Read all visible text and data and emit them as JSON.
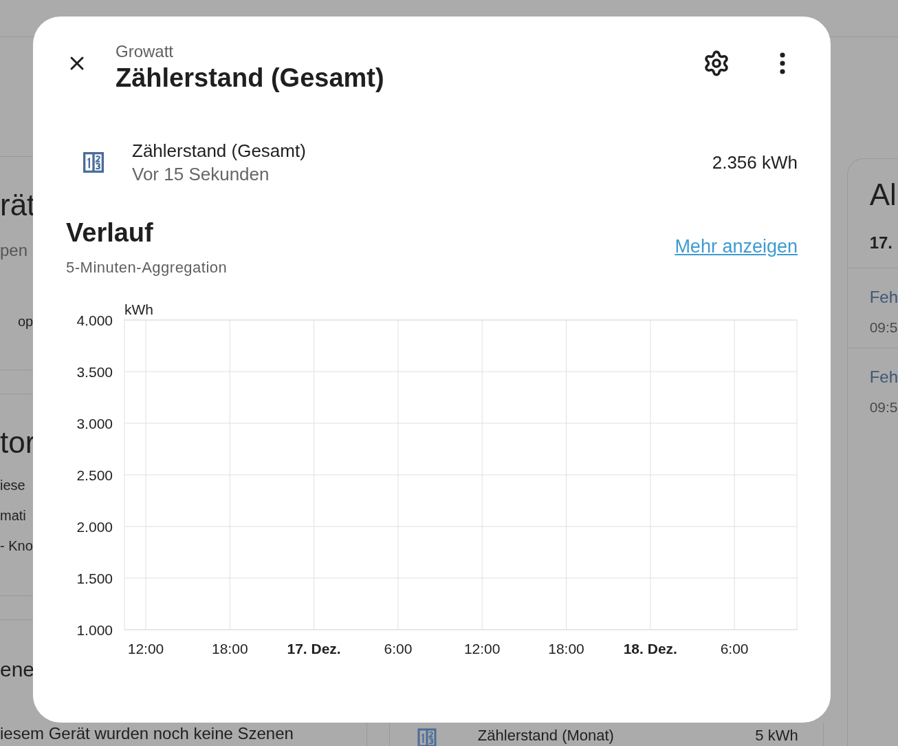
{
  "background": {
    "left_cards": [
      {
        "title": "rät",
        "subtitle": "pen",
        "item": "op"
      },
      {
        "title": "tor",
        "lines": [
          "iese",
          "mati",
          "- Kno"
        ]
      },
      {
        "title": "ene",
        "text": "iesem Gerät wurden noch keine Szenen"
      }
    ],
    "middle_card": {
      "row": {
        "name": "Zählerstand (Monat)",
        "value": "5 kWh"
      }
    },
    "right_card": {
      "title": "Al",
      "date": "17.",
      "entries": [
        {
          "title": "Feh",
          "time": "09:5"
        },
        {
          "title": "Feh",
          "time": "09:5"
        }
      ]
    }
  },
  "dialog": {
    "subtitle": "Growatt",
    "title": "Zählerstand (Gesamt)",
    "entity": {
      "name": "Zählerstand (Gesamt)",
      "last_changed": "Vor 15 Sekunden",
      "state": "2.356 kWh"
    },
    "history": {
      "title": "Verlauf",
      "subtitle": "5-Minuten-Aggregation",
      "link": "Mehr anzeigen",
      "chart_data": {
        "type": "line",
        "ylabel": "kWh",
        "grid": true,
        "ylim": [
          1000,
          4000
        ],
        "categories": [
          "12:00",
          "18:00",
          "**17. Dez.**",
          "6:00",
          "12:00",
          "18:00",
          "**18. Dez.**",
          "6:00"
        ],
        "yticks": [
          {
            "value": 1000,
            "label": "1.000"
          },
          {
            "value": 1500,
            "label": "1.500"
          },
          {
            "value": 2000,
            "label": "2.000"
          },
          {
            "value": 2500,
            "label": "2.500"
          },
          {
            "value": 3000,
            "label": "3.000"
          },
          {
            "value": 3500,
            "label": "3.500"
          },
          {
            "value": 4000,
            "label": "4.000"
          }
        ]
      }
    }
  }
}
